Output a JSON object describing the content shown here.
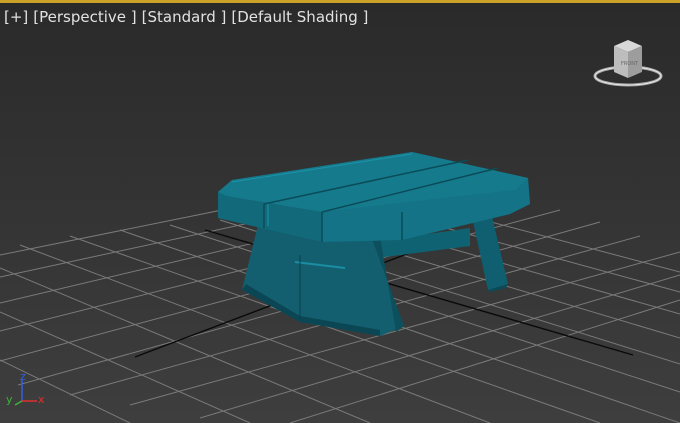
{
  "viewport": {
    "label_plus": "[+]",
    "label_view": "[Perspective ]",
    "label_style": "[Standard ]",
    "label_shading": "[Default Shading ]"
  },
  "viewcube": {
    "icon": "viewcube-icon",
    "face_top": "TOP",
    "face_front": "FRONT"
  },
  "axis_tripod": {
    "x": "x",
    "y": "y",
    "z": "z",
    "colors": {
      "x": "#e03030",
      "y": "#38b838",
      "z": "#3060e0"
    }
  },
  "colors": {
    "model": "#12768a",
    "grid": "#7a7a7a",
    "grid_center": "#0a0a0a",
    "active_border": "#c9a227"
  }
}
